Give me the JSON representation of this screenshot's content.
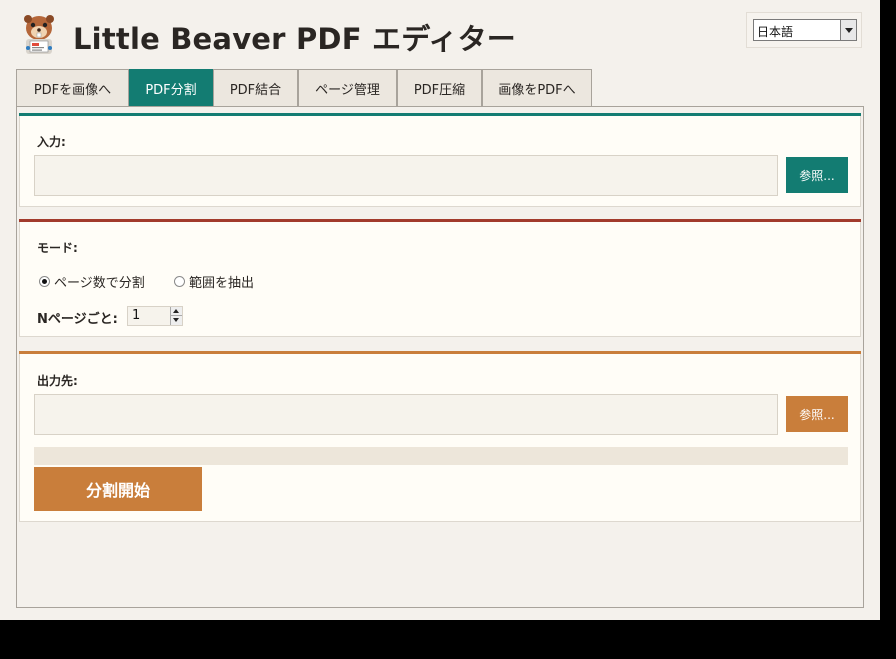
{
  "app": {
    "title": "Little Beaver PDF エディター",
    "logo_icon": "beaver-mascot-icon"
  },
  "language": {
    "selected": "日本語"
  },
  "tabs": [
    {
      "label": "PDFを画像へ",
      "active": false
    },
    {
      "label": "PDF分割",
      "active": true
    },
    {
      "label": "PDF結合",
      "active": false
    },
    {
      "label": "ページ管理",
      "active": false
    },
    {
      "label": "PDF圧縮",
      "active": false
    },
    {
      "label": "画像をPDFへ",
      "active": false
    }
  ],
  "input_section": {
    "label": "入力:",
    "value": "",
    "browse_label": "参照..."
  },
  "mode_section": {
    "label": "モード:",
    "options": [
      {
        "label": "ページ数で分割",
        "checked": true
      },
      {
        "label": "範囲を抽出",
        "checked": false
      }
    ],
    "pages_label": "Nページごと:",
    "pages_value": "1"
  },
  "output_section": {
    "label": "出力先:",
    "value": "",
    "browse_label": "参照..."
  },
  "progress": {
    "fraction": 0
  },
  "start_button": {
    "label": "分割開始"
  },
  "colors": {
    "teal": "#137c72",
    "red_brown": "#a23b2c",
    "orange": "#c97e3b",
    "background": "#f4f1ec",
    "card": "#fffdf7"
  }
}
